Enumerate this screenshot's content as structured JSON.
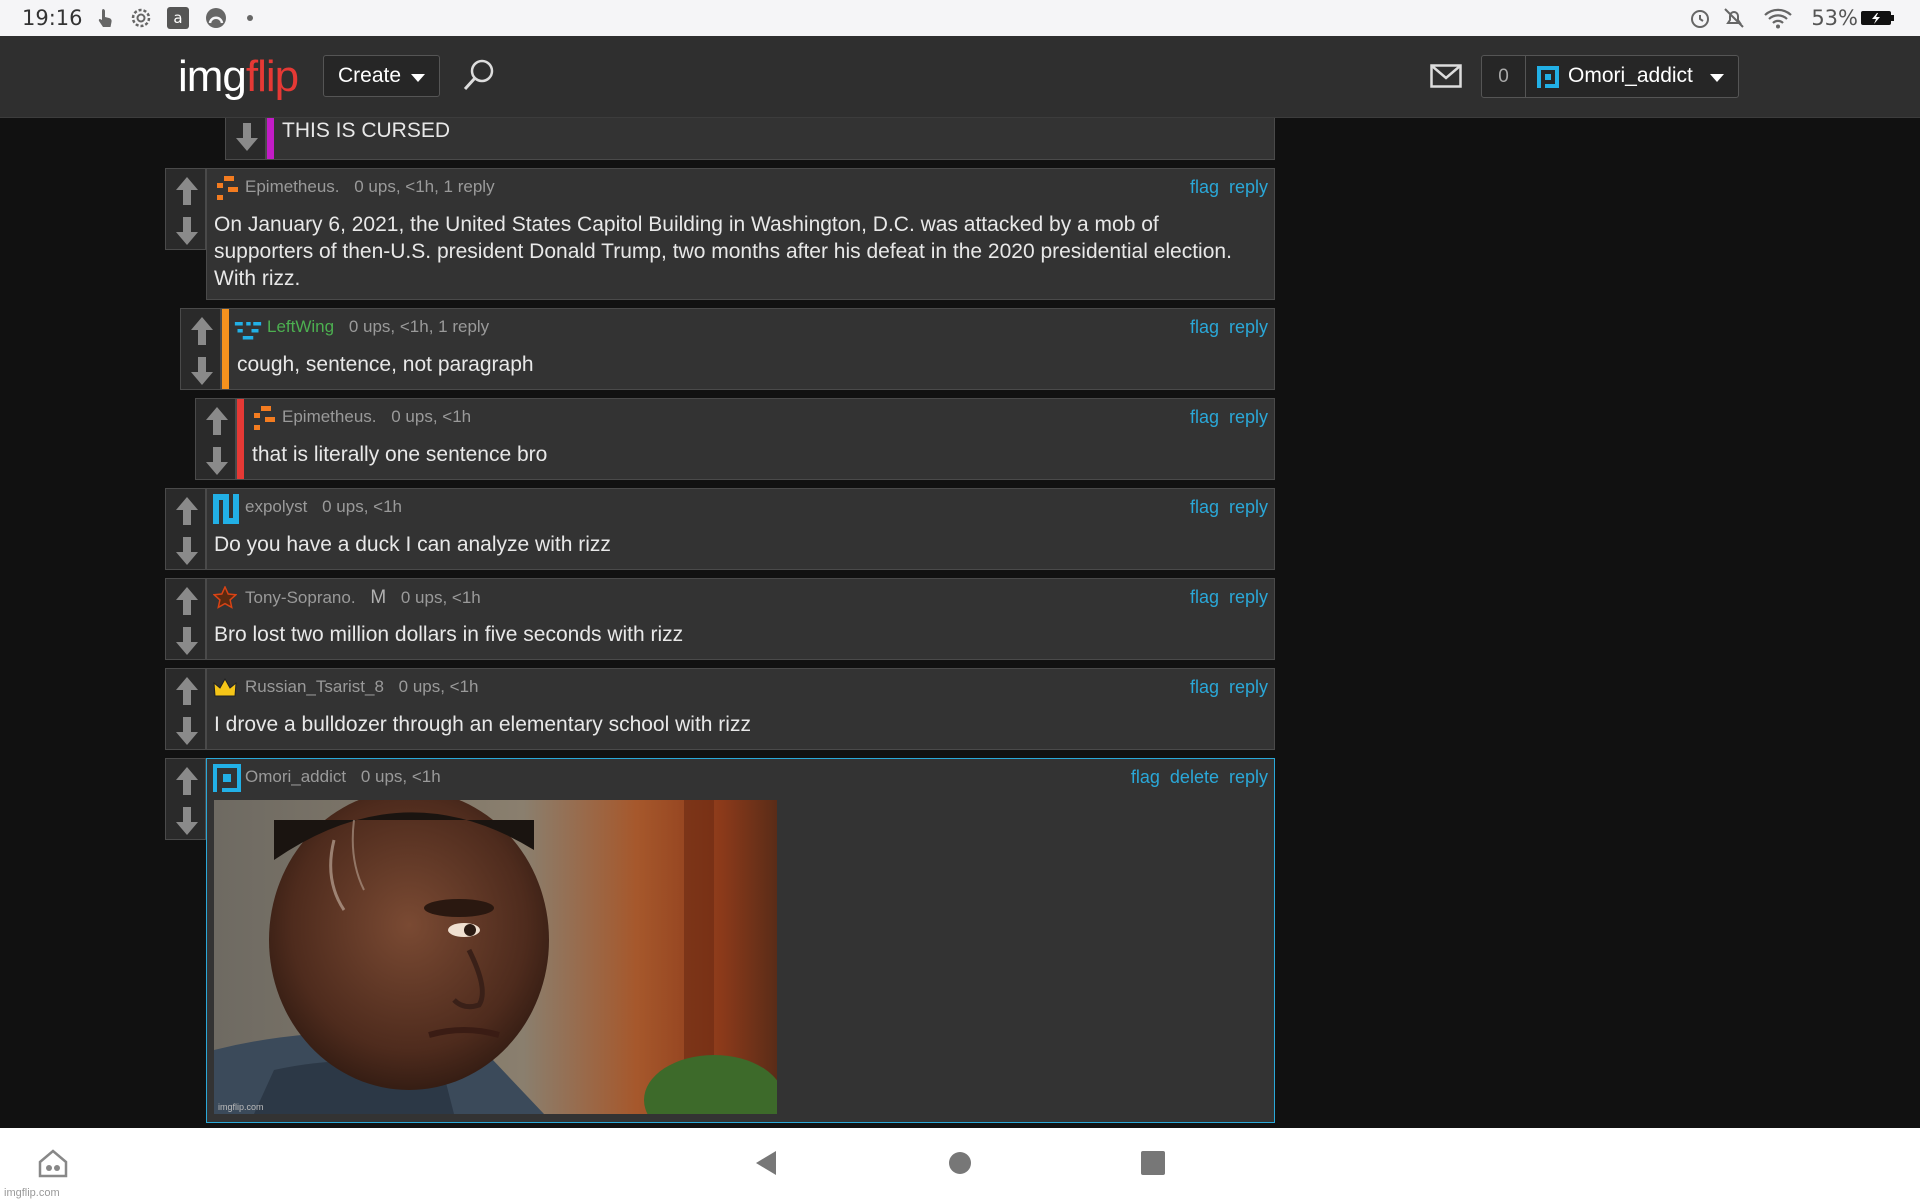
{
  "status_bar": {
    "time": "19:16",
    "battery": "53%",
    "icons": [
      "touch-icon",
      "settings-icon",
      "amazon-icon",
      "arc-app-icon",
      "dot-icon",
      "alarm-icon",
      "bell-off-icon",
      "wifi-icon",
      "battery-charging-icon"
    ]
  },
  "header": {
    "logo_part1": "img",
    "logo_part2": "flip",
    "create_label": "Create",
    "notification_count": "0",
    "username": "Omori_addict"
  },
  "comments": [
    {
      "username": "",
      "meta": "",
      "text": "THIS IS CURSED",
      "bar_color": "#c21cc6",
      "partial": true
    },
    {
      "username": "Epimetheus.",
      "meta": "0 ups, <1h, 1 reply",
      "text": "On January 6, 2021, the United States Capitol Building in Washington, D.C. was attacked by a mob of supporters of then-U.S. president Donald Trump, two months after his defeat in the 2020 presidential election. With rizz.",
      "avatar_color": "#f47c20"
    },
    {
      "username": "LeftWing",
      "meta": "0 ups, <1h, 1 reply",
      "text": "cough, sentence, not paragraph",
      "bar_color": "#f5921e",
      "avatar_color": "#22b0e6"
    },
    {
      "username": "Epimetheus.",
      "meta": "0 ups, <1h",
      "text": "that is literally one sentence bro",
      "bar_color": "#e53935",
      "avatar_color": "#f47c20"
    },
    {
      "username": "expolyst",
      "meta": "0 ups, <1h",
      "text": "Do you have a duck I can analyze with rizz",
      "avatar_color": "#22b0e6"
    },
    {
      "username": "Tony-Soprano.",
      "badge": "M",
      "meta": "0 ups, <1h",
      "text": "Bro lost two million dollars in five seconds with rizz",
      "avatar_color": "#d84315"
    },
    {
      "username": "Russian_Tsarist_8",
      "meta": "0 ups, <1h",
      "text": "I drove a bulldozer through an elementary school with rizz",
      "avatar_color": "#f5c518"
    },
    {
      "username": "Omori_addict",
      "meta": "0 ups, <1h",
      "text": "",
      "avatar_color": "#22b0e6",
      "image_watermark": "imgflip.com"
    }
  ],
  "actions": {
    "flag": "flag",
    "reply": "reply",
    "delete": "delete"
  },
  "page_watermark": "imgflip.com"
}
